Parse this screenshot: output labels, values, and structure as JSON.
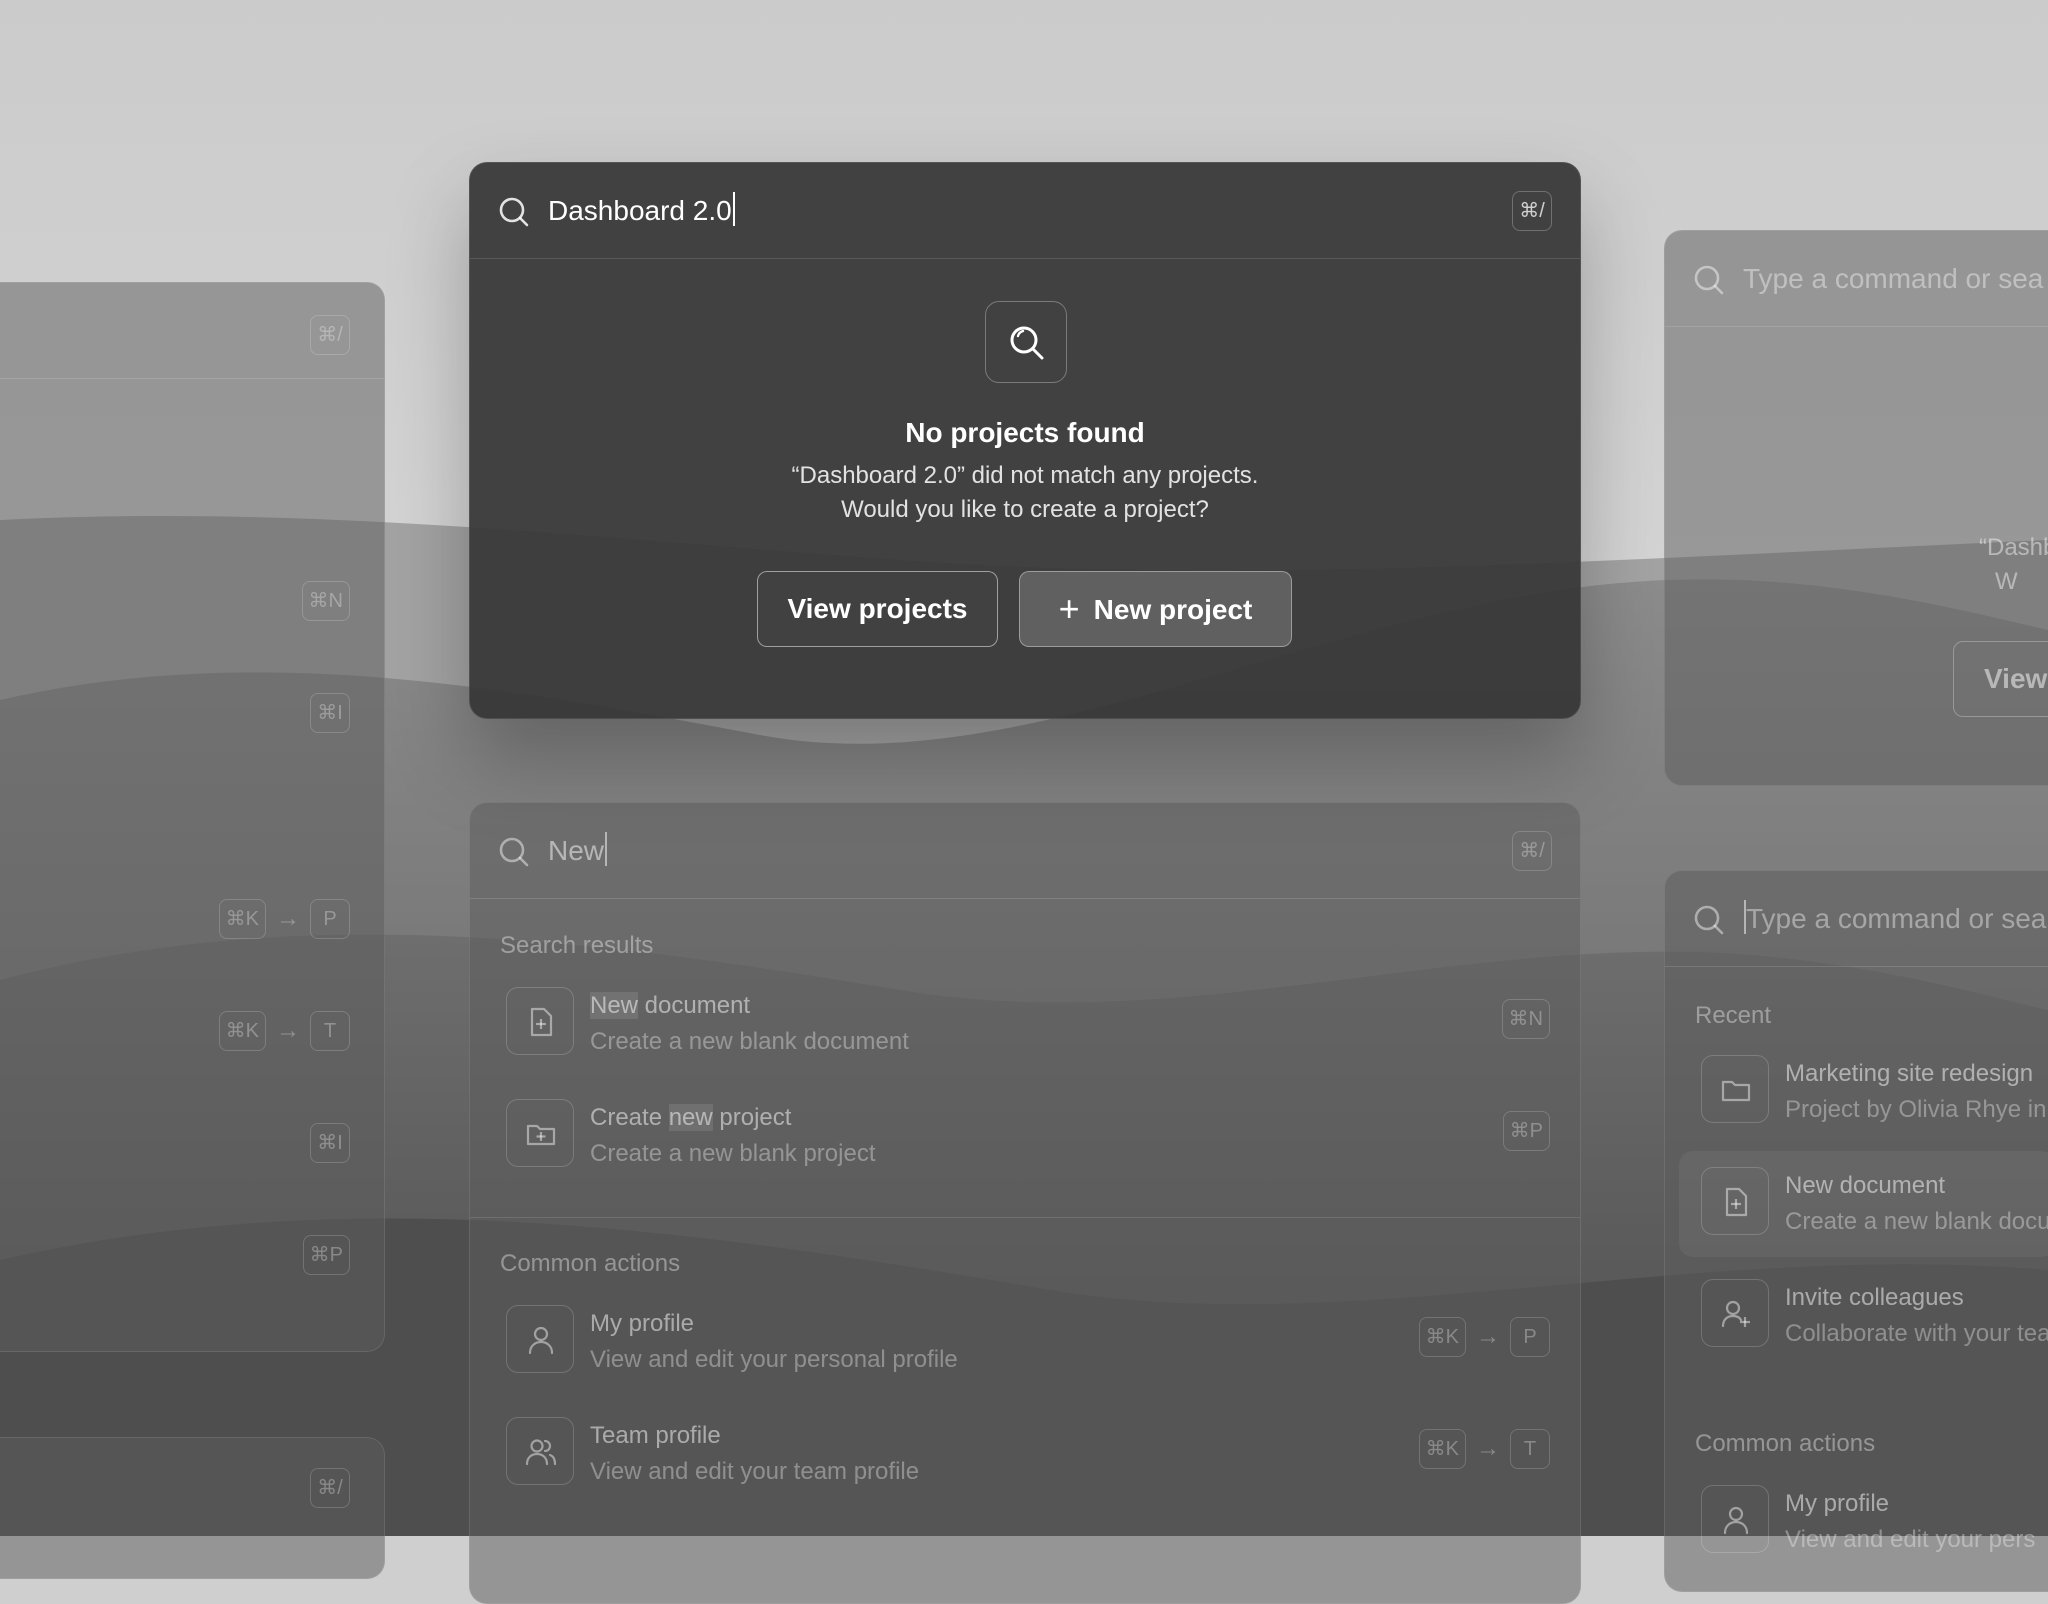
{
  "main_palette": {
    "search": {
      "query": "Dashboard 2.0",
      "shortcut": "⌘/"
    },
    "empty_state": {
      "icon": "search-icon",
      "title": "No projects found",
      "message_line1": "“Dashboard 2.0” did not match any projects.",
      "message_line2": "Would you like to create a project?"
    },
    "buttons": {
      "view_projects": "View projects",
      "new_project": "New project"
    }
  },
  "search_palette": {
    "search": {
      "query": "New",
      "shortcut": "⌘/"
    },
    "search_results_label": "Search results",
    "results": [
      {
        "icon": "file-plus-icon",
        "title_match": "New",
        "title_rest": " document",
        "subtitle": "Create a new blank document",
        "shortcut": "⌘N"
      },
      {
        "icon": "folder-plus-icon",
        "title_pre": "Create ",
        "title_match": "new",
        "title_rest": " project",
        "subtitle": "Create a new blank project",
        "shortcut": "⌘P"
      }
    ],
    "common_actions_label": "Common actions",
    "actions": [
      {
        "icon": "user-icon",
        "title": "My profile",
        "subtitle": "View and edit your personal profile",
        "shortcut_1": "⌘K",
        "shortcut_2": "P"
      },
      {
        "icon": "users-icon",
        "title": "Team profile",
        "subtitle": "View and edit your team profile",
        "shortcut_1": "⌘K",
        "shortcut_2": "T"
      }
    ]
  },
  "left_panels": {
    "top": {
      "shortcut": "⌘/",
      "shortcuts": [
        "⌘N",
        "⌘I",
        "⌘K",
        "P",
        "⌘K",
        "T",
        "⌘I",
        "⌘P"
      ]
    },
    "bottom": {
      "shortcut": "⌘/"
    }
  },
  "right_top_palette": {
    "search_placeholder": "Type a command or sea",
    "partial_message_1": "“Dashb",
    "partial_message_2": "W",
    "partial_button": "View"
  },
  "right_bottom_palette": {
    "search_placeholder": "Type a command or sear",
    "recent_label": "Recent",
    "recent": [
      {
        "icon": "folder-icon",
        "title": "Marketing site redesign",
        "subtitle": "Project by Olivia Rhye in"
      },
      {
        "icon": "file-plus-icon",
        "title": "New document",
        "subtitle": "Create a new blank docu"
      },
      {
        "icon": "user-plus-icon",
        "title": "Invite colleagues",
        "subtitle": "Collaborate with your tea"
      }
    ],
    "common_actions_label": "Common actions",
    "actions": [
      {
        "icon": "user-icon",
        "title": "My profile",
        "subtitle": "View and edit your pers"
      }
    ]
  }
}
